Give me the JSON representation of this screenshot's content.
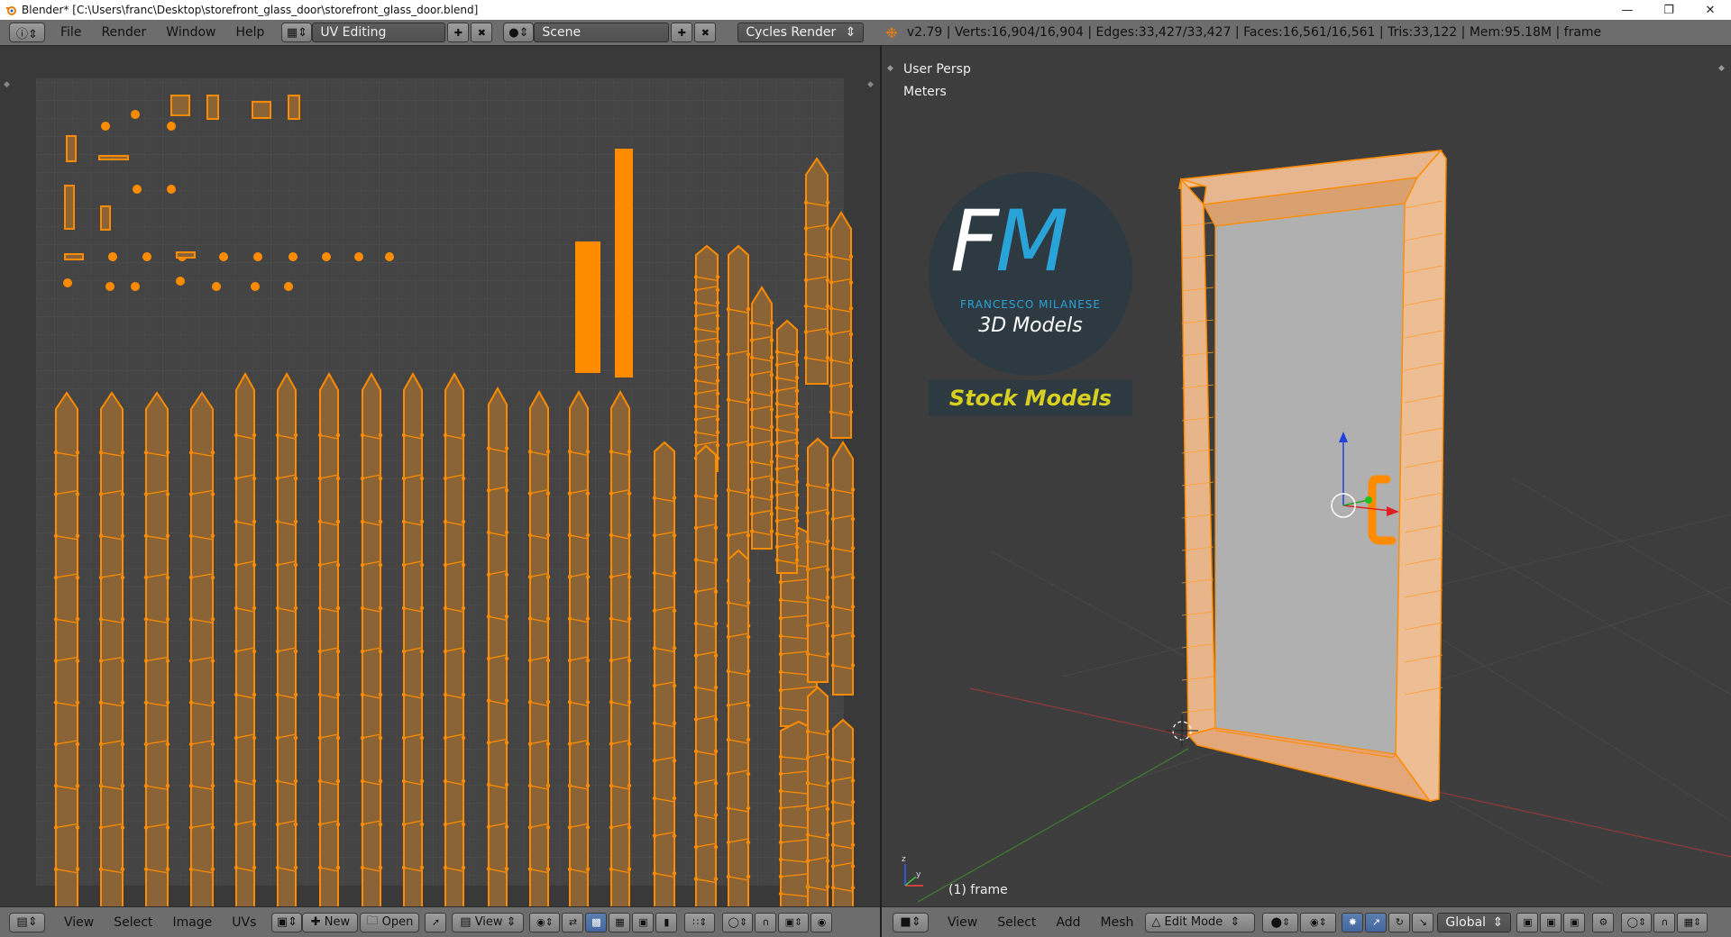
{
  "window": {
    "title": "Blender* [C:\\Users\\franc\\Desktop\\storefront_glass_door\\storefront_glass_door.blend]"
  },
  "info_header": {
    "menus": [
      "File",
      "Render",
      "Window",
      "Help"
    ],
    "screen_layout": "UV Editing",
    "scene": "Scene",
    "engine": "Cycles Render",
    "stats": "v2.79 | Verts:16,904/16,904 | Edges:33,427/33,427 | Faces:16,561/16,561 | Tris:33,122 | Mem:95.18M | frame"
  },
  "uv_editor": {
    "menus": [
      "View",
      "Select",
      "Image",
      "UVs"
    ],
    "new_label": "New",
    "open_label": "Open",
    "view_label": "View"
  },
  "viewport": {
    "view_name": "User Persp",
    "units": "Meters",
    "object_label": "(1) frame",
    "menus": [
      "View",
      "Select",
      "Add",
      "Mesh"
    ],
    "mode": "Edit Mode",
    "orientation": "Global",
    "logo": {
      "letters_f": "F",
      "letters_m": "M",
      "name": "FRANCESCO MILANESE",
      "sub": "3D Models",
      "badge": "Stock Models"
    }
  },
  "colors": {
    "accent": "#ff8c00",
    "uv_fill": "#8a6436",
    "grid": "#4a4a4a"
  }
}
